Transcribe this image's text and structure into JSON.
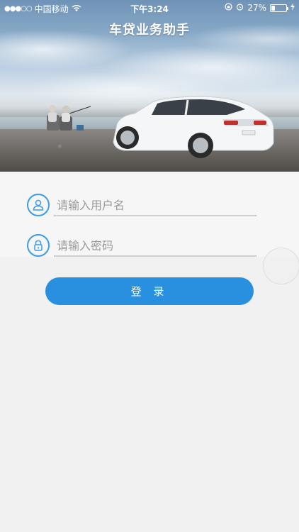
{
  "status_bar": {
    "signal": "●●●○○",
    "carrier": "中国移动",
    "time": "下午3:24",
    "battery_percent": "27%",
    "battery_level": 0.27
  },
  "app": {
    "title": "车贷业务助手"
  },
  "login_form": {
    "username_placeholder": "请输入用户名",
    "password_placeholder": "请输入密码",
    "login_label": "登 录"
  },
  "colors": {
    "accent": "#2990e0",
    "icon_blue": "#3b9be6",
    "background": "#f1f1f1"
  }
}
